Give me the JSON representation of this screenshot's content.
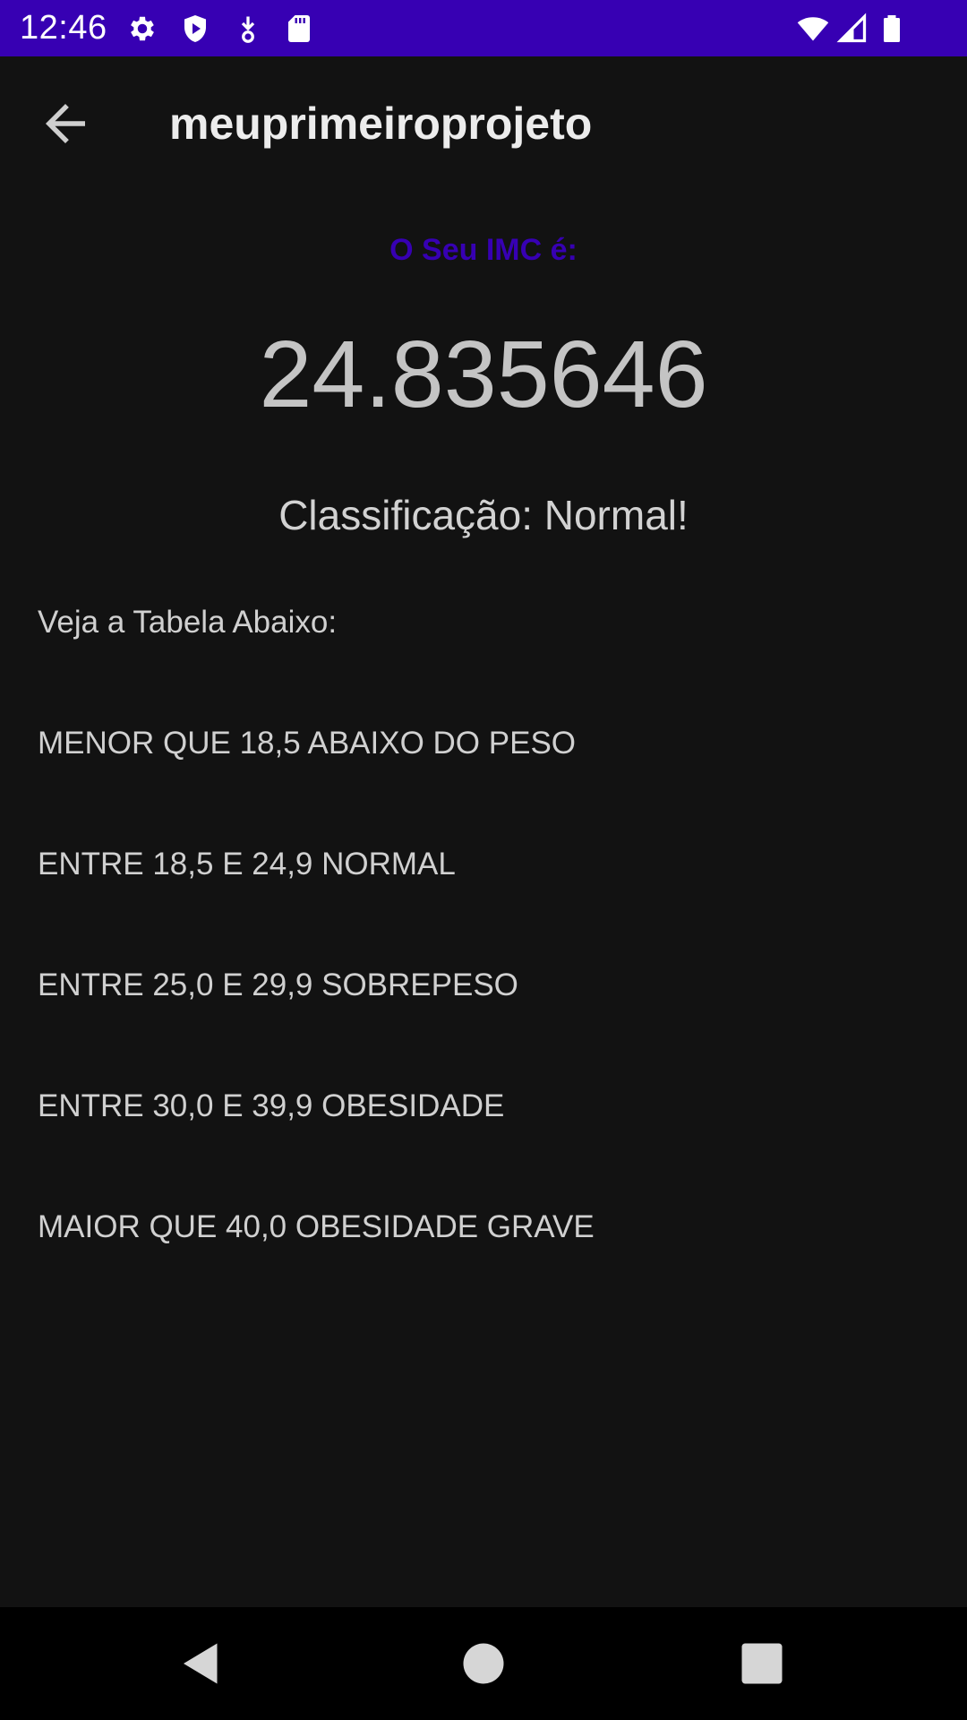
{
  "status_bar": {
    "time": "12:46",
    "left_icons": [
      "gear-icon",
      "shield-play-icon",
      "download-icon",
      "sd-card-icon"
    ],
    "right_icons": [
      "wifi-icon",
      "cell-signal-icon",
      "battery-icon"
    ]
  },
  "app_bar": {
    "title": "meuprimeiroprojeto",
    "back_icon": "arrow-back-icon"
  },
  "result": {
    "label": "O Seu IMC é:",
    "value": "24.835646",
    "classification": "Classificação: Normal!"
  },
  "table": {
    "heading": "Veja a Tabela Abaixo:",
    "rows": [
      "MENOR QUE 18,5 ABAIXO DO PESO",
      "ENTRE 18,5 E 24,9 NORMAL",
      "ENTRE 25,0 E 29,9 SOBREPESO",
      "ENTRE 30,0 E 39,9 OBESIDADE",
      "MAIOR QUE 40,0 OBESIDADE GRAVE"
    ]
  },
  "nav_bar": {
    "buttons": [
      "back-triangle-icon",
      "home-circle-icon",
      "recents-square-icon"
    ]
  },
  "colors": {
    "status_bar": "#3700b3",
    "accent_label": "#3700b3",
    "background": "#121212",
    "nav_bar": "#000000"
  }
}
